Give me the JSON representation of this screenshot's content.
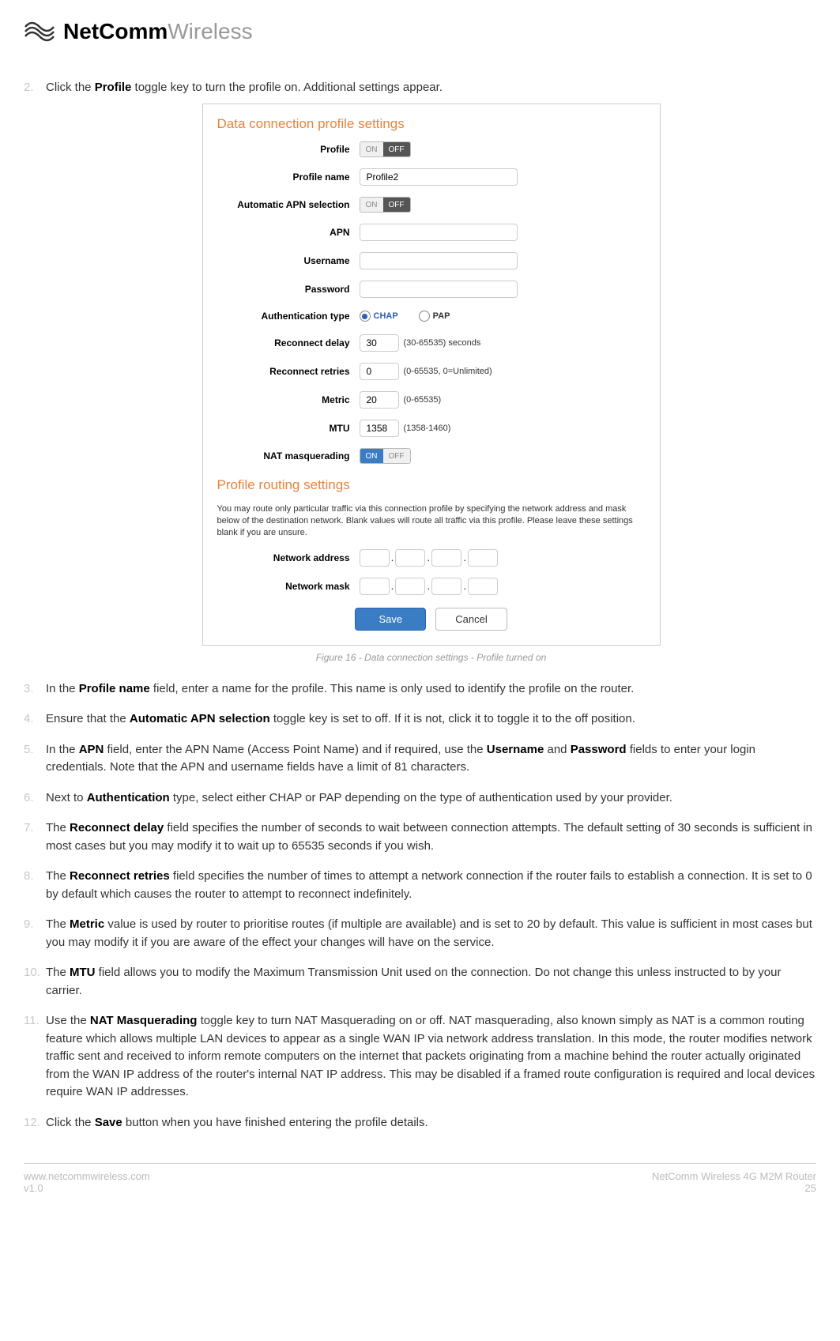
{
  "header": {
    "brand_bold": "NetComm",
    "brand_light": "Wireless"
  },
  "list": {
    "item2_pre": "Click the ",
    "item2_b": "Profile",
    "item2_post": " toggle key to turn the profile on. Additional settings appear.",
    "item3_pre": "In the ",
    "item3_b": "Profile name",
    "item3_post": " field, enter a name for the profile. This name is only used to identify the profile on the router.",
    "item4_pre": "Ensure that the ",
    "item4_b": "Automatic APN selection",
    "item4_post": " toggle key is set to off. If it is not, click it to toggle it to the off position.",
    "item5_pre": "In the ",
    "item5_b1": "APN",
    "item5_mid1": " field, enter the APN Name (Access Point Name) and if required, use the ",
    "item5_b2": "Username",
    "item5_mid2": " and ",
    "item5_b3": "Password",
    "item5_post": " fields to enter your login credentials. Note that the APN and username fields have a limit of 81 characters.",
    "item6_pre": "Next to ",
    "item6_b": "Authentication",
    "item6_post": " type, select either CHAP or PAP depending on the type of authentication used by your provider.",
    "item7_pre": "The ",
    "item7_b": "Reconnect delay",
    "item7_post": " field specifies the number of seconds to wait between connection attempts. The default setting of 30 seconds is sufficient in most cases but you may modify it to wait up to 65535 seconds if you wish.",
    "item8_pre": "The ",
    "item8_b": "Reconnect retries",
    "item8_post": " field specifies the number of times to attempt a network connection if the router fails to establish a connection. It is set to 0 by default which causes the router to attempt to reconnect indefinitely.",
    "item9_pre": "The ",
    "item9_b": "Metric",
    "item9_post": " value is used by router to prioritise routes (if multiple are available) and is set to 20 by default. This value is sufficient in most cases but you may modify it if you are aware of the effect your changes will have on the service.",
    "item10_pre": "The ",
    "item10_b": "MTU",
    "item10_post": " field allows you to modify the Maximum Transmission Unit used on the connection. Do not change this unless instructed to by your carrier.",
    "item11_pre": "Use the ",
    "item11_b": "NAT Masquerading",
    "item11_post": " toggle key to turn NAT Masquerading on or off. NAT masquerading, also known simply as NAT is a common routing feature which allows multiple LAN devices to appear as a single WAN IP via network address translation. In this mode, the router modifies network traffic sent and received to inform remote computers on the internet that packets originating from a machine behind the router actually originated from the WAN IP address of the router's internal NAT IP address. This may be disabled if a framed route configuration is required and local devices require WAN IP addresses.",
    "item12_pre": "Click the ",
    "item12_b": "Save",
    "item12_post": " button when you have finished entering the profile details."
  },
  "screenshot": {
    "heading1": "Data connection profile settings",
    "heading2": "Profile routing settings",
    "routing_desc": "You may route only particular traffic via this connection profile by specifying the network address and mask below of the destination network. Blank values will route all traffic via this profile. Please leave these settings blank if you are unsure.",
    "labels": {
      "profile": "Profile",
      "profile_name": "Profile name",
      "auto_apn": "Automatic APN selection",
      "apn": "APN",
      "username": "Username",
      "password": "Password",
      "auth_type": "Authentication type",
      "reconnect_delay": "Reconnect delay",
      "reconnect_retries": "Reconnect retries",
      "metric": "Metric",
      "mtu": "MTU",
      "nat": "NAT masquerading",
      "net_addr": "Network address",
      "net_mask": "Network mask"
    },
    "toggle": {
      "on": "ON",
      "off": "OFF"
    },
    "values": {
      "profile_name": "Profile2",
      "reconnect_delay": "30",
      "reconnect_retries": "0",
      "metric": "20",
      "mtu": "1358"
    },
    "hints": {
      "reconnect_delay": "(30-65535) seconds",
      "reconnect_retries": "(0-65535, 0=Unlimited)",
      "metric": "(0-65535)",
      "mtu": "(1358-1460)"
    },
    "auth": {
      "chap": "CHAP",
      "pap": "PAP"
    },
    "buttons": {
      "save": "Save",
      "cancel": "Cancel"
    }
  },
  "caption": "Figure 16 - Data connection settings - Profile turned on",
  "footer": {
    "url": "www.netcommwireless.com",
    "version": "v1.0",
    "product": "NetComm Wireless 4G M2M Router",
    "page": "25"
  }
}
